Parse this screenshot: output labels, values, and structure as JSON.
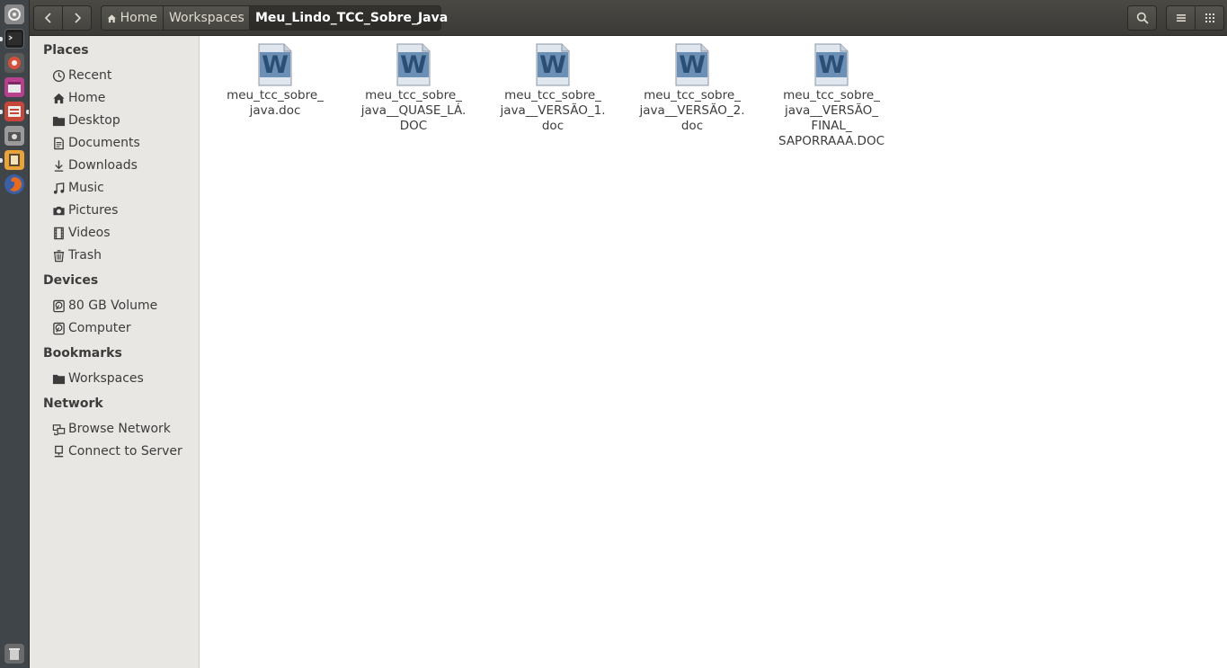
{
  "launcher": {
    "items": [
      {
        "icon": "ubuntu-dash-icon",
        "color": "#c8c8c8"
      },
      {
        "icon": "terminal-icon",
        "color": "#2b2b2b"
      },
      {
        "icon": "settings-wheel-icon",
        "color": "#d6503a"
      },
      {
        "icon": "media-player-icon",
        "color": "#b8418f"
      },
      {
        "icon": "file-manager-icon",
        "color": "#c8453a"
      },
      {
        "icon": "screenshot-icon",
        "color": "#cfcfcf"
      },
      {
        "icon": "text-editor-icon",
        "color": "#e8a33b"
      },
      {
        "icon": "firefox-icon",
        "color": "#e66a1f"
      },
      {
        "icon": "trash-icon",
        "color": "#bdbdbd"
      }
    ]
  },
  "header": {
    "breadcrumbs": [
      "Home",
      "Workspaces",
      "Meu_Lindo_TCC_Sobre_Java"
    ]
  },
  "sidebar": {
    "sections": [
      {
        "title": "Places",
        "items": [
          {
            "label": "Recent",
            "icon": "clock-icon"
          },
          {
            "label": "Home",
            "icon": "home-icon"
          },
          {
            "label": "Desktop",
            "icon": "folder-icon"
          },
          {
            "label": "Documents",
            "icon": "document-icon"
          },
          {
            "label": "Downloads",
            "icon": "download-icon"
          },
          {
            "label": "Music",
            "icon": "music-icon"
          },
          {
            "label": "Pictures",
            "icon": "camera-icon"
          },
          {
            "label": "Videos",
            "icon": "film-icon"
          },
          {
            "label": "Trash",
            "icon": "trash-icon"
          }
        ]
      },
      {
        "title": "Devices",
        "items": [
          {
            "label": "80 GB Volume",
            "icon": "drive-icon"
          },
          {
            "label": "Computer",
            "icon": "drive-icon"
          }
        ]
      },
      {
        "title": "Bookmarks",
        "items": [
          {
            "label": "Workspaces",
            "icon": "folder-icon"
          }
        ]
      },
      {
        "title": "Network",
        "items": [
          {
            "label": "Browse Network",
            "icon": "network-icon"
          },
          {
            "label": "Connect to Server",
            "icon": "server-icon"
          }
        ]
      }
    ]
  },
  "files": [
    {
      "line1": "meu_tcc_sobre_",
      "line2": "java.doc",
      "line3": "",
      "line4": ""
    },
    {
      "line1": "meu_tcc_sobre_",
      "line2": "java__QUASE_LÁ.",
      "line3": "DOC",
      "line4": ""
    },
    {
      "line1": "meu_tcc_sobre_",
      "line2": "java__VERSÃO_1.",
      "line3": "doc",
      "line4": ""
    },
    {
      "line1": "meu_tcc_sobre_",
      "line2": "java__VERSÃO_2.",
      "line3": "doc",
      "line4": ""
    },
    {
      "line1": "meu_tcc_sobre_",
      "line2": "java__VERSÃO_",
      "line3": "FINAL_",
      "line4": "SAPORRAAA.DOC"
    }
  ],
  "colors": {
    "header_bg": "#3e3d39",
    "sidebar_bg": "#e8e7e3",
    "doc_icon_blue": "#2c5f8f"
  }
}
